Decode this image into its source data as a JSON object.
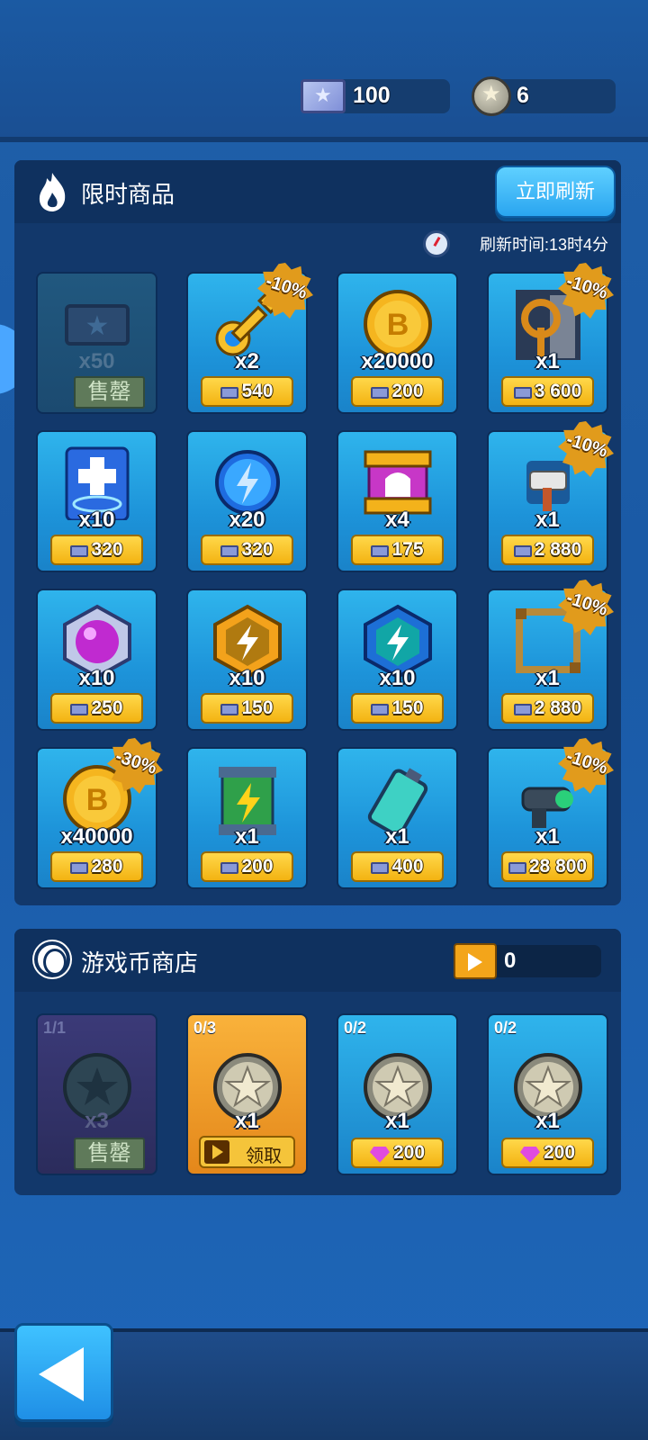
{
  "currency": {
    "tickets": "100",
    "star_coins": "6"
  },
  "limited_shop": {
    "title": "限时商品",
    "refresh_button": "立即刷新",
    "refresh_time": "刷新时间:13时4分",
    "items": [
      {
        "icon": "ticket-icon",
        "qty": "x50",
        "sold_label": "售罄",
        "sold": true
      },
      {
        "icon": "key-icon",
        "qty": "x2",
        "price": "540",
        "discount": "-10%"
      },
      {
        "icon": "gold-coin-icon",
        "qty": "x20000",
        "price": "200"
      },
      {
        "icon": "turret-frame-icon",
        "qty": "x1",
        "price": "3 600",
        "discount": "-10%"
      },
      {
        "icon": "heal-card-icon",
        "qty": "x10",
        "price": "320"
      },
      {
        "icon": "energy-orb-icon",
        "qty": "x20",
        "price": "320"
      },
      {
        "icon": "helmet-chest-icon",
        "qty": "x4",
        "price": "175"
      },
      {
        "icon": "hammer-icon",
        "qty": "x1",
        "price": "2 880",
        "discount": "-10%"
      },
      {
        "icon": "purple-gem-icon",
        "qty": "x10",
        "price": "250"
      },
      {
        "icon": "gold-lightning-badge-icon",
        "qty": "x10",
        "price": "150"
      },
      {
        "icon": "blue-lightning-badge-icon",
        "qty": "x10",
        "price": "150"
      },
      {
        "icon": "square-frame-icon",
        "qty": "x1",
        "price": "2 880",
        "discount": "-10%"
      },
      {
        "icon": "gold-coin-icon",
        "qty": "x40000",
        "price": "280",
        "discount": "-30%"
      },
      {
        "icon": "power-cell-icon",
        "qty": "x1",
        "price": "200"
      },
      {
        "icon": "battery-icon",
        "qty": "x1",
        "price": "400"
      },
      {
        "icon": "cannon-icon",
        "qty": "x1",
        "price": "28 800",
        "discount": "-10%"
      }
    ]
  },
  "coin_shop": {
    "title": "游戏币商店",
    "video_count": "0",
    "items": [
      {
        "limit": "1/1",
        "qty": "x3",
        "sold": true,
        "sold_label": "售罄"
      },
      {
        "limit": "0/3",
        "qty": "x1",
        "claim_label": "领取"
      },
      {
        "limit": "0/2",
        "qty": "x1",
        "price": "200"
      },
      {
        "limit": "0/2",
        "qty": "x1",
        "price": "200"
      }
    ]
  }
}
